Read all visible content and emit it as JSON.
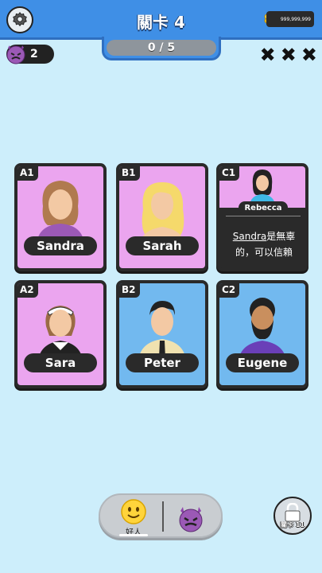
{
  "header": {
    "title": "關卡 4",
    "progress": "0 / 5",
    "coins": "999,999,999"
  },
  "status": {
    "devil_count": "2",
    "strikes": [
      "✖",
      "✖",
      "✖"
    ]
  },
  "cards": [
    {
      "id": "A1",
      "name": "Sandra",
      "bg": "#eba5ef",
      "icon": "woman-brown-hair-avatar"
    },
    {
      "id": "B1",
      "name": "Sarah",
      "bg": "#eba5ef",
      "icon": "woman-blonde-avatar"
    },
    {
      "id": "C1",
      "name": "Rebecca",
      "clue_name": "Sandra",
      "clue_rest": "是無辜的，可以信賴",
      "bg": "#eba5ef",
      "icon": "woman-black-hair-avatar"
    },
    {
      "id": "A2",
      "name": "Sara",
      "bg": "#eba5ef",
      "icon": "maid-avatar"
    },
    {
      "id": "B2",
      "name": "Peter",
      "bg": "#72b9ef",
      "icon": "man-tie-avatar"
    },
    {
      "id": "C2",
      "name": "Eugene",
      "bg": "#72b9ef",
      "icon": "bearded-man-avatar"
    }
  ],
  "bottom": {
    "good_label": "好人",
    "lock_label": "關卡 11"
  }
}
